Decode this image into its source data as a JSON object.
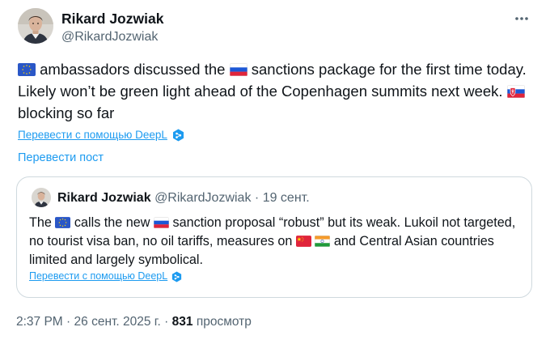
{
  "author": {
    "name": "Rikard Jozwiak",
    "handle": "@RikardJozwiak"
  },
  "tweet": {
    "segments": [
      " ambassadors discussed the ",
      " sanctions package for the first time today. Likely won’t be green light ahead of the Copenhagen summits next week. ",
      " blocking so far"
    ],
    "flags": [
      "eu-flag-icon",
      "russia-flag-icon",
      "slovakia-flag-icon"
    ]
  },
  "translate_deepl_label": "Перевести с помощью DeepL",
  "translate_post_label": "Перевести пост",
  "quote": {
    "name": "Rikard Jozwiak",
    "handle": "@RikardJozwiak",
    "separator": "·",
    "date": "19 сент.",
    "segments": [
      "The ",
      " calls the new ",
      " sanction proposal “robust” but its weak. Lukoil not targeted, no tourist visa ban, no oil tariffs, measures on ",
      " ",
      " and Central Asian countries limited and largely symbolical."
    ],
    "flags": [
      "eu-flag-icon",
      "russia-flag-icon",
      "china-flag-icon",
      "india-flag-icon"
    ],
    "translate_label": "Перевести с помощью DeepL"
  },
  "meta": {
    "time": "2:37 PM",
    "separator": "·",
    "date": "26 сент. 2025 г.",
    "views_count": "831",
    "views_label": "просмотр"
  },
  "colors": {
    "link": "#1d9bf0",
    "secondary_text": "#536471",
    "border": "#cfd9de"
  }
}
